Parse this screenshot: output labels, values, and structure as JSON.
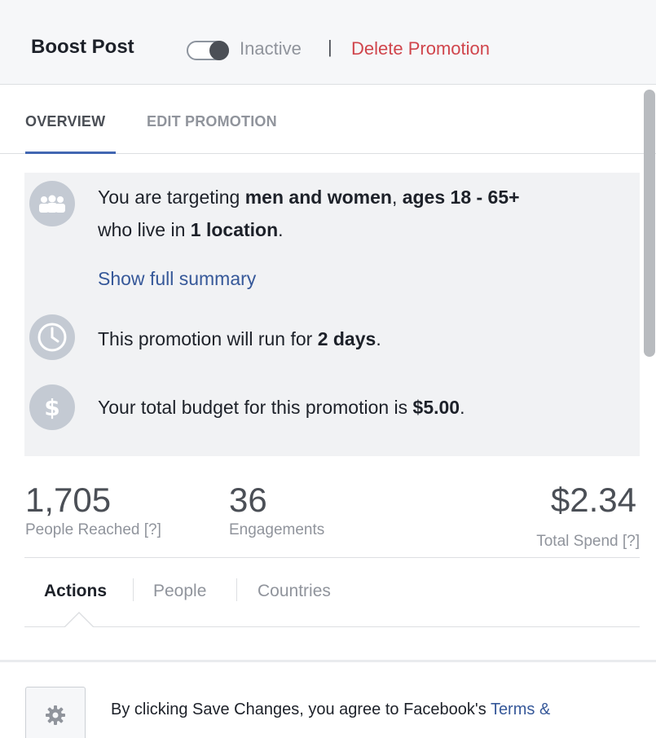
{
  "header": {
    "title": "Boost Post",
    "status": "Inactive",
    "separator": "|",
    "delete_label": "Delete Promotion"
  },
  "tabs": [
    {
      "label": "OVERVIEW",
      "active": true
    },
    {
      "label": "EDIT PROMOTION",
      "active": false
    }
  ],
  "summary": {
    "targeting": {
      "icon": "people-icon",
      "prefix": "You are targeting ",
      "audience": "men and women",
      "comma": ", ",
      "ages": "ages 18 - 65+",
      "line2_prefix": "who live in ",
      "locations": "1 location",
      "period": "."
    },
    "show_full_summary": "Show full summary",
    "duration": {
      "icon": "clock-icon",
      "prefix": "This promotion will run for ",
      "value": "2 days",
      "period": "."
    },
    "budget": {
      "icon": "dollar-icon",
      "prefix": "Your total budget for this promotion is ",
      "value": "$5.00",
      "period": "."
    }
  },
  "stats": {
    "reached": {
      "value": "1,705",
      "label": "People Reached",
      "help": "[?]"
    },
    "engagements": {
      "value": "36",
      "label": "Engagements"
    },
    "spend": {
      "value": "$2.34",
      "label": "Total Spend",
      "help": "[?]"
    }
  },
  "subtabs": [
    {
      "label": "Actions",
      "active": true
    },
    {
      "label": "People",
      "active": false
    },
    {
      "label": "Countries",
      "active": false
    }
  ],
  "footer": {
    "gear_icon": "gear-icon",
    "text": "By clicking Save Changes, you agree to Facebook's ",
    "terms_link": "Terms &"
  },
  "colors": {
    "link": "#365899",
    "delete": "#d0454c",
    "tab_underline": "#4267b2",
    "summary_bg": "#f1f2f4",
    "icon_circle": "#c4cad3"
  }
}
